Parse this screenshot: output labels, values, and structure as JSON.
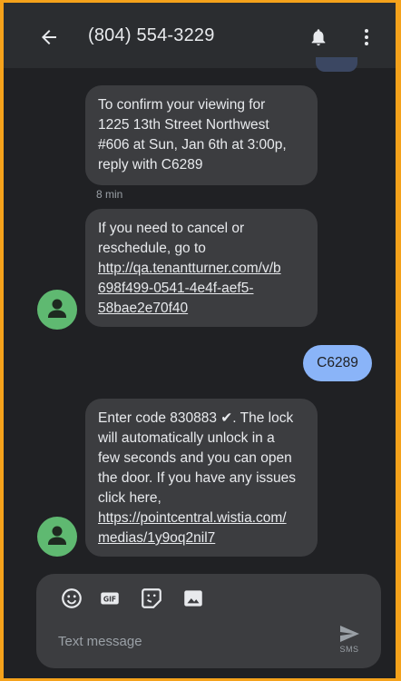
{
  "header": {
    "title": "(804) 554-3229",
    "back_icon": "arrow-back-icon",
    "bell_icon": "bell-icon",
    "menu_icon": "more-vert-icon"
  },
  "messages": [
    {
      "direction": "incoming",
      "lines": [
        "To confirm your viewing for",
        "1225 13th Street Northwest",
        "#606 at Sun, Jan 6th at 3:00p,",
        "reply with C6289"
      ],
      "time": "8 min"
    },
    {
      "direction": "incoming",
      "lines": [
        "If you need to cancel or",
        "reschedule, go to"
      ],
      "link_lines": [
        "http://qa.tenantturner.com/v/b",
        "698f499-0541-4e4f-aef5-",
        "58bae2e70f40"
      ]
    },
    {
      "direction": "outgoing",
      "text": "C6289"
    },
    {
      "direction": "incoming",
      "lines": [
        "Enter code 830883 ✔.  The lock",
        "will automatically unlock in a",
        "few seconds and you can open",
        "the door. If you have any issues",
        "click here,"
      ],
      "link_lines": [
        "https://pointcentral.wistia.com/",
        "medias/1y9oq2nil7"
      ]
    }
  ],
  "compose": {
    "placeholder": "Text message",
    "send_label": "SMS",
    "tools": [
      "emoji-icon",
      "gif-icon",
      "sticker-icon",
      "image-icon"
    ]
  },
  "colors": {
    "frame": "#f5a21b",
    "background": "#202124",
    "header": "#2b2d30",
    "incoming_bubble": "#3c3d40",
    "outgoing_bubble": "#8ab4f8",
    "avatar": "#5fb971"
  }
}
